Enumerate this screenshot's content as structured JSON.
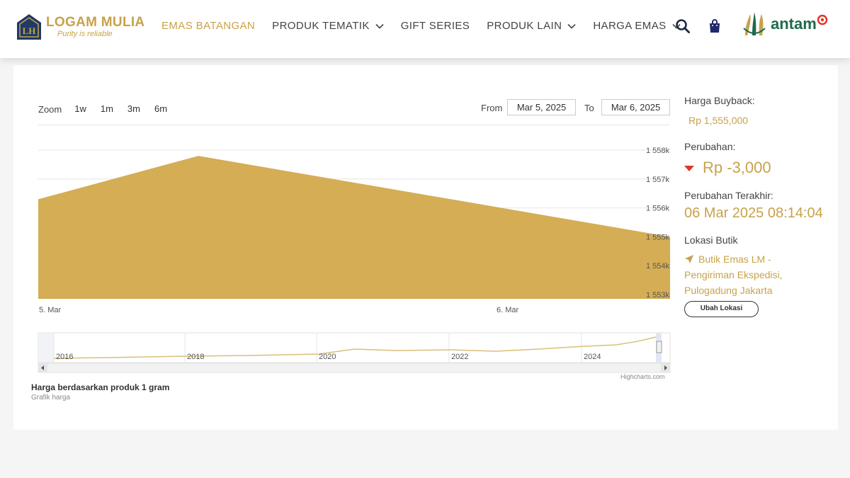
{
  "header": {
    "logo_title": "LOGAM MULIA",
    "logo_tagline": "Purity is reliable",
    "logo_badge_text": "LH",
    "nav": [
      {
        "label": "EMAS BATANGAN",
        "active": true,
        "dropdown": false
      },
      {
        "label": "PRODUK TEMATIK",
        "active": false,
        "dropdown": true
      },
      {
        "label": "GIFT SERIES",
        "active": false,
        "dropdown": false
      },
      {
        "label": "PRODUK LAIN",
        "active": false,
        "dropdown": true
      },
      {
        "label": "HARGA EMAS",
        "active": false,
        "dropdown": true
      }
    ],
    "icons": [
      "search-icon",
      "shopping-bag-icon"
    ],
    "partner": "antam"
  },
  "chart_controls": {
    "zoom_label": "Zoom",
    "zoom_buttons": [
      "1w",
      "1m",
      "3m",
      "6m"
    ],
    "from_label": "From",
    "from_value": "Mar 5, 2025",
    "to_label": "To",
    "to_value": "Mar 6, 2025"
  },
  "chart_data": {
    "type": "area",
    "x": [
      "5. Mar",
      "",
      "6. Mar"
    ],
    "x_tick_labels": [
      "5. Mar",
      "6. Mar"
    ],
    "values": [
      1556300,
      1557800,
      1555000
    ],
    "y_ticks": [
      "1 553k",
      "1 554k",
      "1 555k",
      "1 556k",
      "1 557k",
      "1 558k"
    ],
    "ylim": [
      1553000,
      1558000
    ],
    "color": "#d4ad55",
    "navigator_years": [
      "2016",
      "2018",
      "2020",
      "2022",
      "2024"
    ],
    "navigator_line_color": "#d9c07a",
    "grid": true,
    "credits": "Highcharts.com"
  },
  "caption": {
    "title": "Harga berdasarkan produk 1 gram",
    "subtitle": "Grafik harga"
  },
  "side": {
    "buyback_label": "Harga Buyback:",
    "buyback_value": "Rp 1,555,000",
    "change_label": "Perubahan:",
    "change_value": "Rp -3,000",
    "last_change_label": "Perubahan Terakhir:",
    "last_change_value": "06 Mar 2025 08:14:04",
    "location_label": "Lokasi Butik",
    "location_value": "Butik Emas LM - Pengiriman Ekspedisi, Pulogadung Jakarta",
    "change_location_button": "Ubah Lokasi"
  },
  "colors": {
    "gold": "#c8a24a",
    "down": "#e0352b",
    "antam_green": "#1e6a4c"
  }
}
